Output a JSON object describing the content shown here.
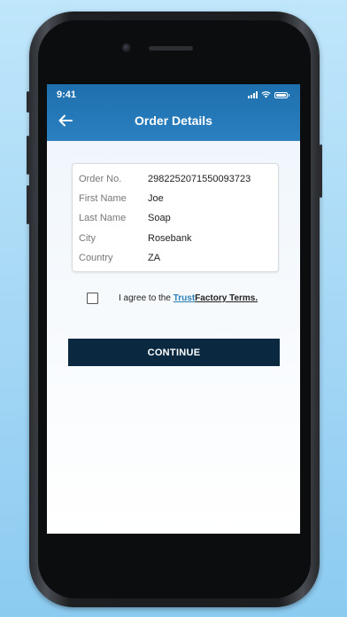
{
  "status_bar": {
    "time": "9:41"
  },
  "app_bar": {
    "title": "Order Details",
    "back_icon": "back-arrow-icon"
  },
  "order": {
    "rows": [
      {
        "label": "Order No.",
        "value": "2982252071550093723"
      },
      {
        "label": "First Name",
        "value": "Joe"
      },
      {
        "label": "Last Name",
        "value": "Soap"
      },
      {
        "label": "City",
        "value": "Rosebank"
      },
      {
        "label": "Country",
        "value": "ZA"
      }
    ]
  },
  "agreement": {
    "prefix": "I agree to the ",
    "link_part1": "Trust",
    "link_part2": "Factory Terms.",
    "checked": false
  },
  "continue_label": "CONTINUE",
  "colors": {
    "app_bar": "#2272b2",
    "button": "#0a2940",
    "link": "#2b7fb8",
    "background": "#a6d8f5"
  }
}
